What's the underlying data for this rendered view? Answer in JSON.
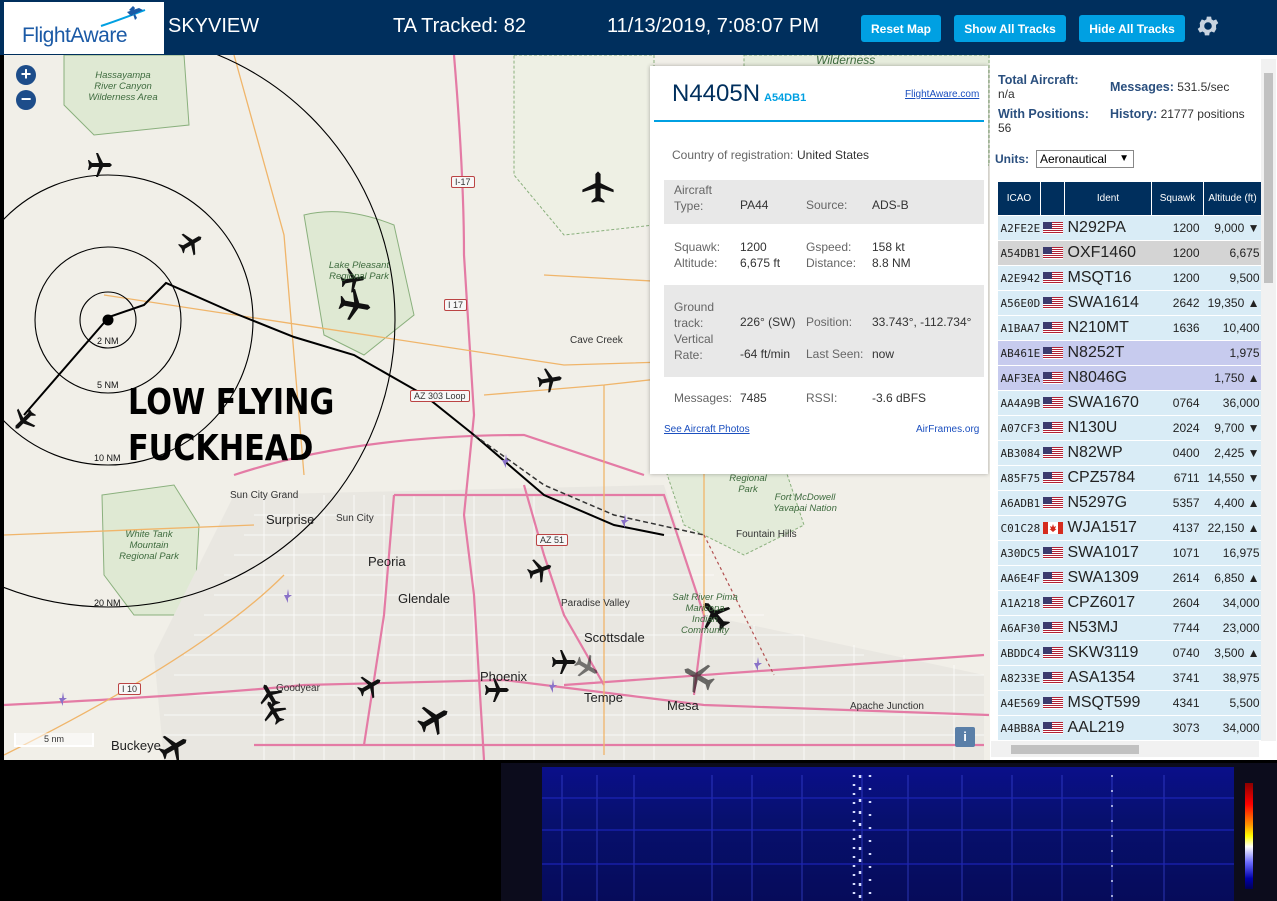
{
  "header": {
    "logo_text": "FlightAware",
    "app_name": "SKYVIEW",
    "tracked": "TA Tracked: 82",
    "datetime": "11/13/2019, 7:08:07 PM",
    "buttons": {
      "reset": "Reset Map",
      "show_all": "Show All Tracks",
      "hide_all": "Hide All Tracks"
    }
  },
  "map": {
    "zoom_in": "+",
    "zoom_out": "−",
    "rings": [
      "2 NM",
      "5 NM",
      "10 NM",
      "20 NM"
    ],
    "overlay_text": [
      "LOW FLYING",
      "FUCKHEAD"
    ],
    "scale": "5 nm",
    "info": "i",
    "places": {
      "hassayampa": "Hassayampa River Canyon Wilderness Area",
      "wilderness": "Wilderness",
      "lake_pleasant": "Lake Pleasant Regional Park",
      "cave_creek": "Cave Creek",
      "sun_city_grand": "Sun City Grand",
      "surprise": "Surprise",
      "sun_city": "Sun City",
      "white_tank": "White Tank Mountain Regional Park",
      "peoria": "Peoria",
      "glendale": "Glendale",
      "paradise_valley": "Paradise Valley",
      "scottsdale": "Scottsdale",
      "phoenix": "Phoenix",
      "tempe": "Tempe",
      "mesa": "Mesa",
      "goodyear": "Goodyear",
      "buckeye": "Buckeye",
      "apache_junction": "Apache Junction",
      "fountain_hills": "Fountain Hills",
      "fort_mcdowell": "Fort McDowell Yavapai Nation",
      "salt_river": "Salt River Pima Maricopa Indian Community",
      "regional_park": "Regional Park"
    },
    "roads": {
      "i17a": "I-17",
      "i17b": "I 17",
      "az303": "AZ 303 Loop",
      "az51": "AZ 51",
      "i10": "I 10"
    }
  },
  "popup": {
    "callsign": "N4405N",
    "hex": "A54DB1",
    "fa_link": "FlightAware.com",
    "country_label": "Country of registration:",
    "country": "United States",
    "aircraft_type_label": "Aircraft Type:",
    "aircraft_type": "PA44",
    "source_label": "Source:",
    "source": "ADS-B",
    "squawk_label": "Squawk:",
    "squawk": "1200",
    "altitude_label": "Altitude:",
    "altitude": "6,675 ft",
    "gspeed_label": "Gspeed:",
    "gspeed": "158 kt",
    "distance_label": "Distance:",
    "distance": "8.8 NM",
    "ground_track_label": "Ground track:",
    "ground_track": "226° (SW)",
    "position_label": "Position:",
    "position": "33.743°, -112.734°",
    "vertical_rate_label": "Vertical Rate:",
    "vertical_rate": "-64 ft/min",
    "last_seen_label": "Last Seen:",
    "last_seen": "now",
    "messages_label": "Messages:",
    "messages": "7485",
    "rssi_label": "RSSI:",
    "rssi": "-3.6 dBFS",
    "photos_link": "See Aircraft Photos",
    "airframes_link": "AirFrames.org"
  },
  "stats": {
    "total_label": "Total Aircraft:",
    "total": "n/a",
    "messages_label": "Messages:",
    "messages": "531.5/sec",
    "positions_label": "With Positions:",
    "positions": "56",
    "history_label": "History:",
    "history": "21777 positions",
    "units_label": "Units:",
    "units": "Aeronautical"
  },
  "table": {
    "headers": {
      "icao": "ICAO",
      "ident": "Ident",
      "squawk": "Squawk",
      "altitude": "Altitude (ft)"
    },
    "rows": [
      {
        "icao": "A2FE2E",
        "flag": "us",
        "ident": "N292PA",
        "squawk": "1200",
        "alt": "9,000 ▼",
        "style": "r"
      },
      {
        "icao": "A54DB1",
        "flag": "us",
        "ident": "OXF1460",
        "squawk": "1200",
        "alt": "6,675",
        "style": "sel"
      },
      {
        "icao": "A2E942",
        "flag": "us",
        "ident": "MSQT16",
        "squawk": "1200",
        "alt": "9,500",
        "style": "r"
      },
      {
        "icao": "A56E0D",
        "flag": "us",
        "ident": "SWA1614",
        "squawk": "2642",
        "alt": "19,350 ▲",
        "style": "r"
      },
      {
        "icao": "A1BAA7",
        "flag": "us",
        "ident": "N210MT",
        "squawk": "1636",
        "alt": "10,400",
        "style": "r"
      },
      {
        "icao": "AB461E",
        "flag": "us",
        "ident": "N8252T",
        "squawk": "",
        "alt": "1,975",
        "style": "hl"
      },
      {
        "icao": "AAF3EA",
        "flag": "us",
        "ident": "N8046G",
        "squawk": "",
        "alt": "1,750 ▲",
        "style": "hl"
      },
      {
        "icao": "AA4A9B",
        "flag": "us",
        "ident": "SWA1670",
        "squawk": "0764",
        "alt": "36,000",
        "style": "r"
      },
      {
        "icao": "A07CF3",
        "flag": "us",
        "ident": "N130U",
        "squawk": "2024",
        "alt": "9,700 ▼",
        "style": "r"
      },
      {
        "icao": "AB3084",
        "flag": "us",
        "ident": "N82WP",
        "squawk": "0400",
        "alt": "2,425 ▼",
        "style": "r"
      },
      {
        "icao": "A85F75",
        "flag": "us",
        "ident": "CPZ5784",
        "squawk": "6711",
        "alt": "14,550 ▼",
        "style": "r"
      },
      {
        "icao": "A6ADB1",
        "flag": "us",
        "ident": "N5297G",
        "squawk": "5357",
        "alt": "4,400 ▲",
        "style": "r"
      },
      {
        "icao": "C01C28",
        "flag": "ca",
        "ident": "WJA1517",
        "squawk": "4137",
        "alt": "22,150 ▲",
        "style": "r"
      },
      {
        "icao": "A30DC5",
        "flag": "us",
        "ident": "SWA1017",
        "squawk": "1071",
        "alt": "16,975",
        "style": "r"
      },
      {
        "icao": "AA6E4F",
        "flag": "us",
        "ident": "SWA1309",
        "squawk": "2614",
        "alt": "6,850 ▲",
        "style": "r"
      },
      {
        "icao": "A1A218",
        "flag": "us",
        "ident": "CPZ6017",
        "squawk": "2604",
        "alt": "34,000",
        "style": "r"
      },
      {
        "icao": "A6AF30",
        "flag": "us",
        "ident": "N53MJ",
        "squawk": "7744",
        "alt": "23,000",
        "style": "r"
      },
      {
        "icao": "ABDDC4",
        "flag": "us",
        "ident": "SKW3119",
        "squawk": "0740",
        "alt": "3,500 ▲",
        "style": "r"
      },
      {
        "icao": "A8233E",
        "flag": "us",
        "ident": "ASA1354",
        "squawk": "3741",
        "alt": "38,975",
        "style": "r"
      },
      {
        "icao": "A4E569",
        "flag": "us",
        "ident": "MSQT599",
        "squawk": "4341",
        "alt": "5,500",
        "style": "r"
      },
      {
        "icao": "A4BB8A",
        "flag": "us",
        "ident": "AAL219",
        "squawk": "3073",
        "alt": "34,000",
        "style": "r"
      }
    ]
  },
  "colors": {
    "header_bg": "#002f5d",
    "accent": "#00a0e2",
    "row_bg": "#d9ecf6",
    "row_selected": "#d4d4d4",
    "row_highlight": "#c7cbee"
  },
  "icons": [
    "gear-icon",
    "plane-icon",
    "flag-us-icon",
    "flag-ca-icon",
    "zoom-in-icon",
    "zoom-out-icon"
  ]
}
